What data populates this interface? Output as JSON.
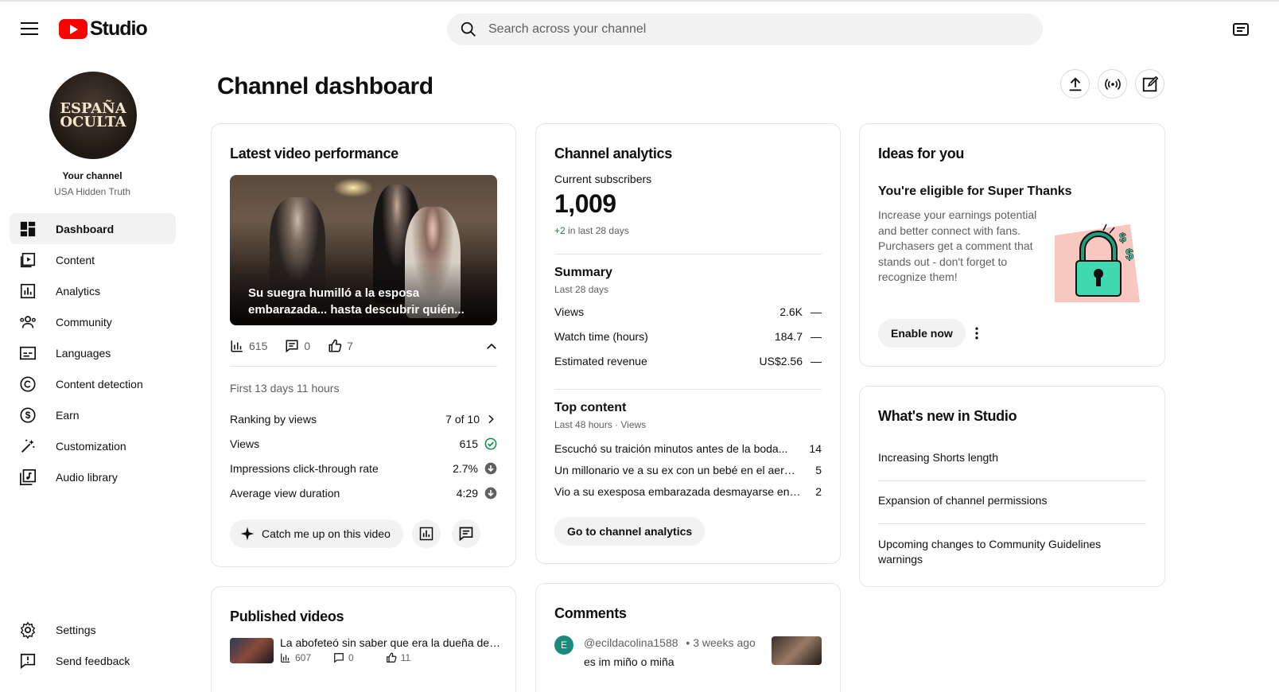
{
  "app": {
    "logo_text": "Studio",
    "search_placeholder": "Search across your channel"
  },
  "sidebar": {
    "avatar_text_line1": "ESPAÑA",
    "avatar_text_line2": "OCULTA",
    "your_channel": "Your channel",
    "channel_name": "USA Hidden Truth",
    "items": [
      {
        "label": "Dashboard",
        "icon": "dashboard-icon",
        "active": true
      },
      {
        "label": "Content",
        "icon": "content-icon"
      },
      {
        "label": "Analytics",
        "icon": "analytics-icon"
      },
      {
        "label": "Community",
        "icon": "community-icon"
      },
      {
        "label": "Languages",
        "icon": "languages-icon"
      },
      {
        "label": "Content detection",
        "icon": "copyright-icon"
      },
      {
        "label": "Earn",
        "icon": "dollar-icon"
      },
      {
        "label": "Customization",
        "icon": "magic-wand-icon"
      },
      {
        "label": "Audio library",
        "icon": "audio-library-icon"
      }
    ],
    "bottom_items": [
      {
        "label": "Settings",
        "icon": "gear-icon"
      },
      {
        "label": "Send feedback",
        "icon": "feedback-icon"
      }
    ]
  },
  "page": {
    "title": "Channel dashboard"
  },
  "latest_video": {
    "title": "Latest video performance",
    "video_title": "Su suegra humilló a la esposa embarazada... hasta descubrir quién...",
    "views": "615",
    "comments": "0",
    "likes": "7",
    "period": "First 13 days 11 hours",
    "metrics": [
      {
        "label": "Ranking by views",
        "value": "7 of 10"
      },
      {
        "label": "Views",
        "value": "615"
      },
      {
        "label": "Impressions click-through rate",
        "value": "2.7%"
      },
      {
        "label": "Average view duration",
        "value": "4:29"
      }
    ],
    "catch_up_label": "Catch me up on this video"
  },
  "analytics": {
    "title": "Channel analytics",
    "subs_label": "Current subscribers",
    "subs_value": "1,009",
    "subs_delta": "+2",
    "subs_delta_suffix": "in last 28 days",
    "summary_title": "Summary",
    "summary_period": "Last 28 days",
    "summary_rows": [
      {
        "label": "Views",
        "value": "2.6K",
        "trend": "—"
      },
      {
        "label": "Watch time (hours)",
        "value": "184.7",
        "trend": "—"
      },
      {
        "label": "Estimated revenue",
        "value": "US$2.56",
        "trend": "—"
      }
    ],
    "top_title": "Top content",
    "top_period": "Last 48 hours · Views",
    "top_rows": [
      {
        "title": "Escuchó su traición minutos antes de la boda...",
        "value": "14"
      },
      {
        "title": "Un millonario ve a su ex con un bebé en el aeropu...",
        "value": "5"
      },
      {
        "title": "Vio a su exesposa embarazada desmayarse en la ...",
        "value": "2"
      }
    ],
    "go_button": "Go to channel analytics"
  },
  "ideas": {
    "title": "Ideas for you",
    "heading": "You're eligible for Super Thanks",
    "body": "Increase your earnings potential and better connect with fans. Purchasers get a comment that stands out - don't forget to recognize them!",
    "button": "Enable now"
  },
  "whats_new": {
    "title": "What's new in Studio",
    "items": [
      "Increasing Shorts length",
      "Expansion of channel permissions",
      "Upcoming changes to Community Guidelines warnings"
    ]
  },
  "published": {
    "title": "Published videos",
    "items": [
      {
        "title": "La abofeteó sin saber que era la dueña de l...",
        "views": "607",
        "comments": "0",
        "likes": "11"
      }
    ]
  },
  "comments": {
    "title": "Comments",
    "items": [
      {
        "avatar_letter": "E",
        "author": "@ecildacolina1588",
        "time": "• 3 weeks ago",
        "text": "es im miño o miña",
        "avatar_color": "#1a8a7a"
      }
    ]
  }
}
